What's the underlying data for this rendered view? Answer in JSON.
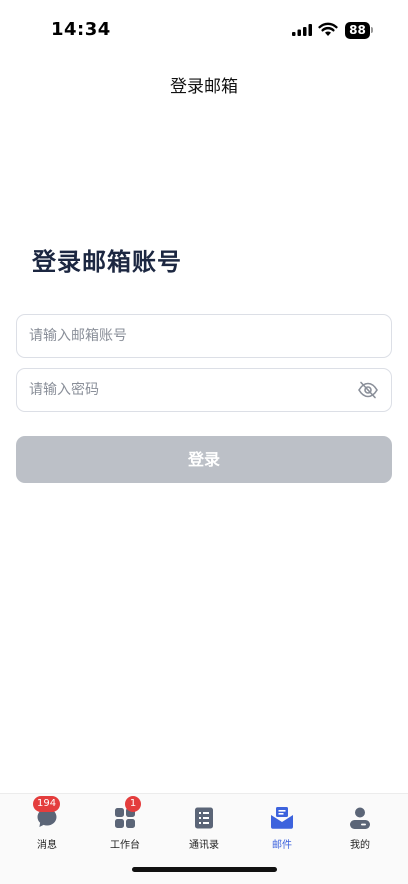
{
  "status_bar": {
    "time": "14:34",
    "battery": "88"
  },
  "nav": {
    "title": "登录邮箱"
  },
  "form": {
    "heading": "登录邮箱账号",
    "account_placeholder": "请输入邮箱账号",
    "password_placeholder": "请输入密码",
    "login_label": "登录"
  },
  "tabs": [
    {
      "label": "消息",
      "icon": "chat-icon",
      "badge": "194"
    },
    {
      "label": "工作台",
      "icon": "grid-icon",
      "badge": "1"
    },
    {
      "label": "通讯录",
      "icon": "contacts-icon"
    },
    {
      "label": "邮件",
      "icon": "mail-icon",
      "active": true
    },
    {
      "label": "我的",
      "icon": "user-icon"
    }
  ],
  "colors": {
    "accent": "#3d63dd",
    "button_disabled": "#bcc0c7",
    "badge": "#e43d3d",
    "heading": "#1c2741"
  }
}
